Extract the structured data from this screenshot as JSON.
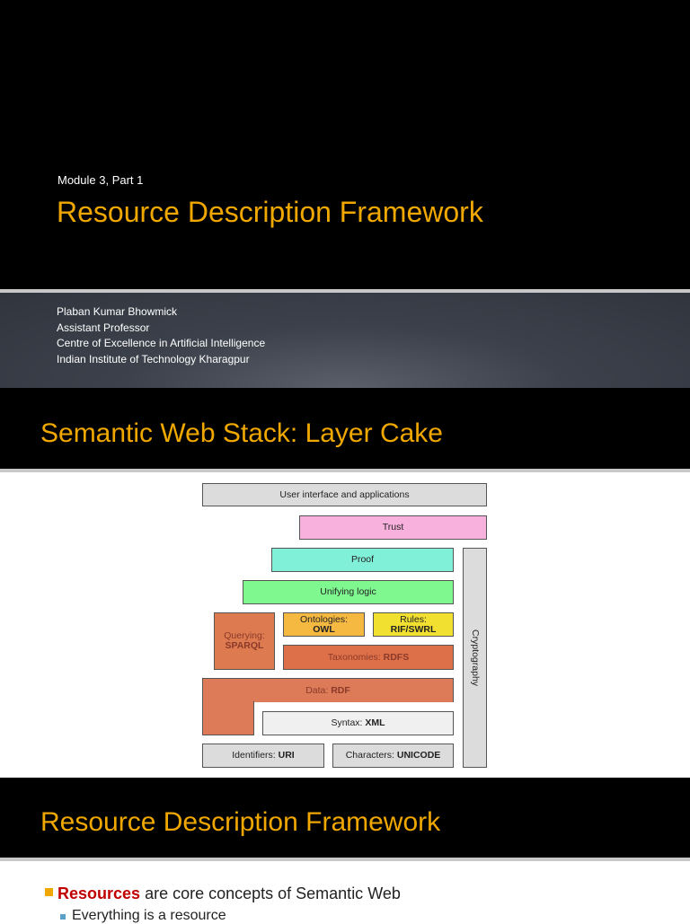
{
  "slide1": {
    "module": "Module 3, Part 1",
    "title": "Resource Description Framework",
    "author": [
      "Plaban Kumar Bhowmick",
      "Assistant Professor",
      "Centre of Excellence in Artificial Intelligence",
      "Indian Institute of Technology Kharagpur"
    ]
  },
  "slide2": {
    "title": "Semantic Web Stack: Layer Cake",
    "layers": {
      "ui": "User interface and applications",
      "trust": "Trust",
      "proof": "Proof",
      "logic": "Unifying logic",
      "query_label": "Querying:",
      "query_value": "SPARQL",
      "onto_label": "Ontologies:",
      "onto_value": "OWL",
      "rules_label": "Rules:",
      "rules_value": "RIF/SWRL",
      "tax_label": "Taxonomies: ",
      "tax_value": "RDFS",
      "data_label": "Data: ",
      "data_value": "RDF",
      "syntax_label": "Syntax: ",
      "syntax_value": "XML",
      "id_label": "Identifiers: ",
      "id_value": "URI",
      "char_label": "Characters: ",
      "char_value": "UNICODE",
      "crypto": "Cryptography"
    }
  },
  "slide3": {
    "title": "Resource Description Framework",
    "bullet_highlight": "Resources",
    "bullet_rest": " are core concepts of Semantic Web",
    "sub_bullet": "Everything is a resource"
  },
  "colors": {
    "accent": "#f0a800",
    "highlight": "#c00000"
  }
}
